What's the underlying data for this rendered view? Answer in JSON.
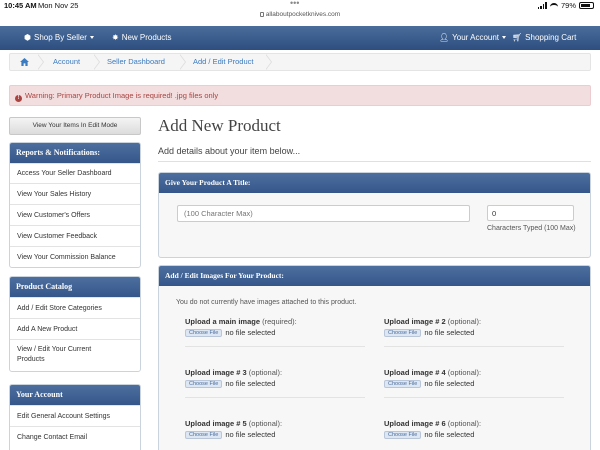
{
  "status_bar": {
    "time": "10:45 AM",
    "date": "Mon Nov 25",
    "url": "allaboutpocketknives.com",
    "battery": "79%"
  },
  "navbar": {
    "shop_by_seller": "Shop By Seller",
    "new_products": "New Products",
    "your_account": "Your Account",
    "shopping_cart": "Shopping Cart"
  },
  "breadcrumb": {
    "items": [
      "Account",
      "Seller Dashboard",
      "Add / Edit Product"
    ]
  },
  "warning": {
    "text": "Warning: Primary Product Image is required! .jpg files only"
  },
  "sidebar": {
    "edit_mode_button": "View Your Items In Edit Mode",
    "reports": {
      "title": "Reports & Notifications:",
      "items": [
        "Access Your Seller Dashboard",
        "View Your Sales History",
        "View Customer's Offers",
        "View Customer Feedback",
        "View Your Commission Balance"
      ]
    },
    "catalog": {
      "title": "Product Catalog",
      "items": [
        "Add / Edit Store Categories",
        "Add A New Product",
        "View / Edit Your Current Products"
      ]
    },
    "account": {
      "title": "Your Account",
      "items": [
        "Edit General Account Settings",
        "Change Contact Email"
      ]
    }
  },
  "main": {
    "title": "Add New Product",
    "subtitle": "Add details about your item below...",
    "title_box": {
      "heading": "Give Your Product A Title:",
      "placeholder": "(100 Character Max)",
      "count_value": "0",
      "count_label": "Characters Typed (100 Max)"
    },
    "images_box": {
      "heading": "Add / Edit Images For Your Product:",
      "note": "You do not currently have images attached to this product.",
      "choose_label": "Choose File",
      "no_file": "no file selected",
      "uploads": [
        {
          "label": "Upload a main image",
          "suffix": "(required):"
        },
        {
          "label": "Upload image # 2",
          "suffix": "(optional):"
        },
        {
          "label": "Upload image # 3",
          "suffix": "(optional):"
        },
        {
          "label": "Upload image # 4",
          "suffix": "(optional):"
        },
        {
          "label": "Upload image # 5",
          "suffix": "(optional):"
        },
        {
          "label": "Upload image # 6",
          "suffix": "(optional):"
        }
      ]
    }
  },
  "colors": {
    "nav_blue": "#3a5c8d",
    "link_blue": "#3b7bbf",
    "warning_red": "#a94442"
  }
}
